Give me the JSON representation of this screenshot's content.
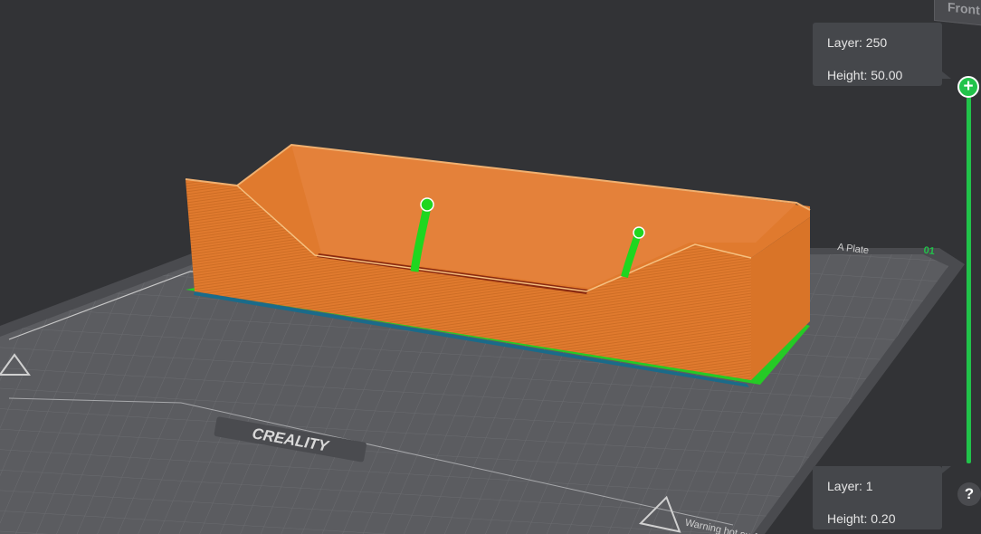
{
  "viewport": {
    "view_cube_label": "Front"
  },
  "layer_slider": {
    "top": {
      "layer_label": "Layer: 250",
      "height_label": "Height: 50.00"
    },
    "bottom": {
      "layer_label": "Layer: 1",
      "height_label": "Height: 0.20"
    },
    "handle_symbol": "+",
    "accent_color": "#21c34a"
  },
  "build_plate": {
    "brand_text": "CREALITY",
    "plate_label": "A Plate",
    "plate_number": "01",
    "warning_text": "Warning hot surface",
    "surface_color": "#5b5c60"
  },
  "model": {
    "color": "#e07a2e",
    "support_color": "#1fd61f"
  },
  "help_button": {
    "label": "?"
  }
}
